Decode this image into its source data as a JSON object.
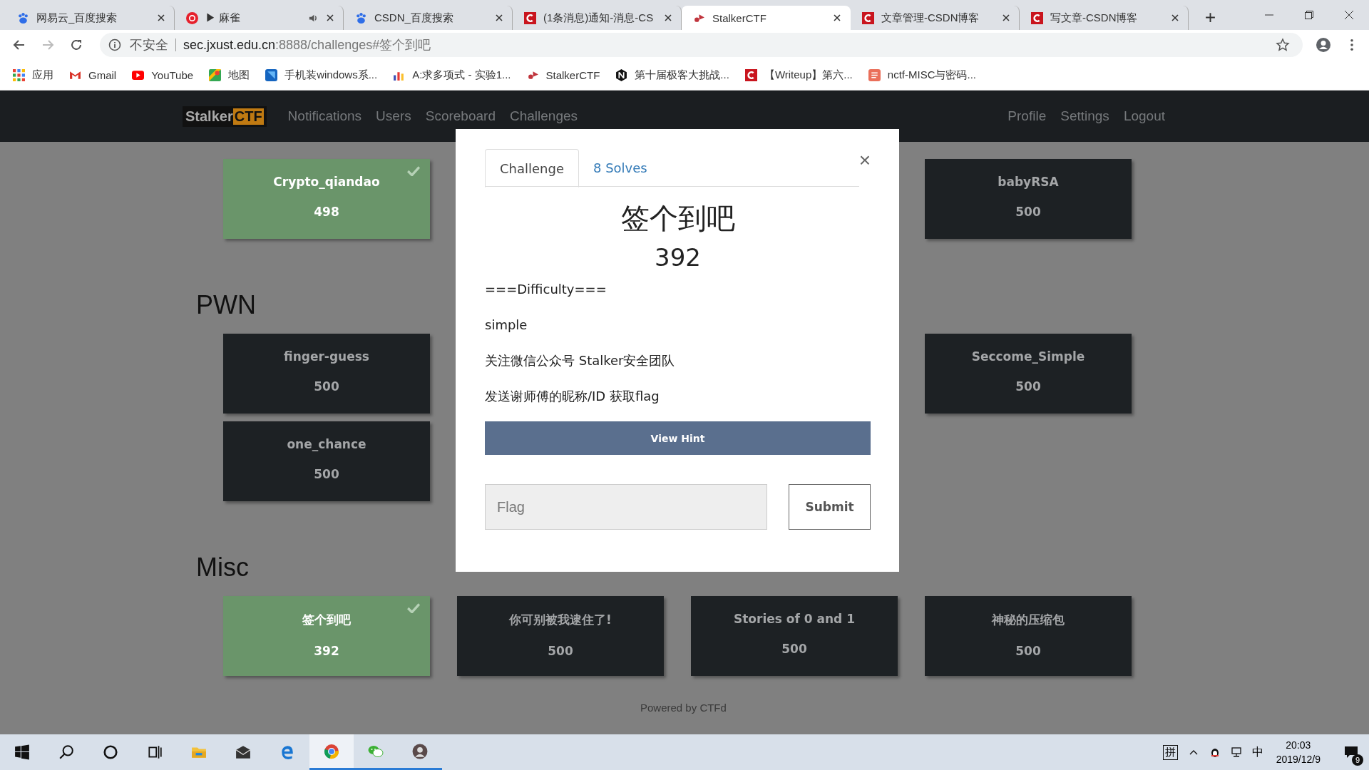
{
  "browser": {
    "tabs": [
      {
        "title": "网易云_百度搜索",
        "kind": "paw",
        "audio": false,
        "selected": false
      },
      {
        "title": "▶ 麻雀",
        "kind": "music",
        "audio": true,
        "selected": false
      },
      {
        "title": "CSDN_百度搜索",
        "kind": "paw",
        "audio": false,
        "selected": false
      },
      {
        "title": "(1条消息)通知-消息-CS",
        "kind": "letter",
        "audio": false,
        "selected": false
      },
      {
        "title": "StalkerCTF",
        "kind": "flag",
        "audio": false,
        "selected": true
      },
      {
        "title": "文章管理-CSDN博客",
        "kind": "letter",
        "audio": false,
        "selected": false
      },
      {
        "title": "写文章-CSDN博客",
        "kind": "letter",
        "audio": false,
        "selected": false
      }
    ],
    "security": "不安全",
    "url_host": "sec.jxust.edu.cn",
    "url_rest": ":8888/challenges#签个到吧",
    "bookmarks": [
      {
        "title": "应用",
        "kind": "grid"
      },
      {
        "title": "Gmail",
        "kind": "mail"
      },
      {
        "title": "YouTube",
        "kind": "play"
      },
      {
        "title": "地图",
        "kind": "map"
      },
      {
        "title": "手机装windows系...",
        "kind": "square"
      },
      {
        "title": "A:求多项式 - 实验1...",
        "kind": "bars"
      },
      {
        "title": "StalkerCTF",
        "kind": "flag"
      },
      {
        "title": "第十届极客大挑战...",
        "kind": "hex"
      },
      {
        "title": "【Writeup】第六...",
        "kind": "letter"
      },
      {
        "title": "nctf-MISC与密码...",
        "kind": "note"
      }
    ]
  },
  "site": {
    "logo_left": "Stalker",
    "logo_right": "CTF",
    "nav_left": [
      "Notifications",
      "Users",
      "Scoreboard",
      "Challenges"
    ],
    "nav_right": [
      "Profile",
      "Settings",
      "Logout"
    ],
    "sections": [
      {
        "rows": [
          [
            {
              "name": "Crypto_qiandao",
              "points": "498",
              "solved": true
            },
            {
              "name": "babyRSA",
              "points": "500",
              "solved": false
            }
          ]
        ]
      },
      {
        "title": "PWN",
        "rows": [
          [
            {
              "name": "finger-guess",
              "points": "500",
              "solved": false
            },
            {
              "name": "Seccome_Simple",
              "points": "500",
              "solved": false
            }
          ],
          [
            {
              "name": "one_chance",
              "points": "500",
              "solved": false
            }
          ]
        ]
      },
      {
        "title": "Misc",
        "rows": [
          [
            {
              "name": "签个到吧",
              "points": "392",
              "solved": true
            },
            {
              "name": "你可别被我逮住了!",
              "points": "500",
              "solved": false
            },
            {
              "name": "Stories of 0 and 1",
              "points": "500",
              "solved": false
            },
            {
              "name": "神秘的压缩包",
              "points": "500",
              "solved": false
            }
          ]
        ]
      }
    ],
    "footer": "Powered by CTFd"
  },
  "modal": {
    "tabs": [
      {
        "label": "Challenge",
        "selected": true
      },
      {
        "label": "8 Solves",
        "selected": false
      }
    ],
    "close": "×",
    "title": "签个到吧",
    "value": "392",
    "description": [
      "===Difficulty===",
      "simple",
      "关注微信公众号 Stalker安全团队",
      "发送谢师傅的昵称/ID 获取flag"
    ],
    "hint_button": "View Hint",
    "flag_placeholder": "Flag",
    "submit": "Submit"
  },
  "taskbar": {
    "apps": [
      {
        "kind": "windows",
        "running": false,
        "selected": false
      },
      {
        "kind": "search",
        "running": false,
        "selected": false
      },
      {
        "kind": "circle",
        "running": false,
        "selected": false
      },
      {
        "kind": "taskview",
        "running": false,
        "selected": false
      },
      {
        "kind": "folder",
        "running": false,
        "selected": false
      },
      {
        "kind": "envelope",
        "running": false,
        "selected": false
      },
      {
        "kind": "browser-e",
        "running": false,
        "selected": false
      },
      {
        "kind": "chrome",
        "running": true,
        "selected": true
      },
      {
        "kind": "chat",
        "running": true,
        "selected": false
      },
      {
        "kind": "avatar",
        "running": true,
        "selected": false
      }
    ],
    "ime": "拼",
    "lang": "中",
    "time": "20:03",
    "date": "2019/12/9",
    "notifications": "9"
  }
}
